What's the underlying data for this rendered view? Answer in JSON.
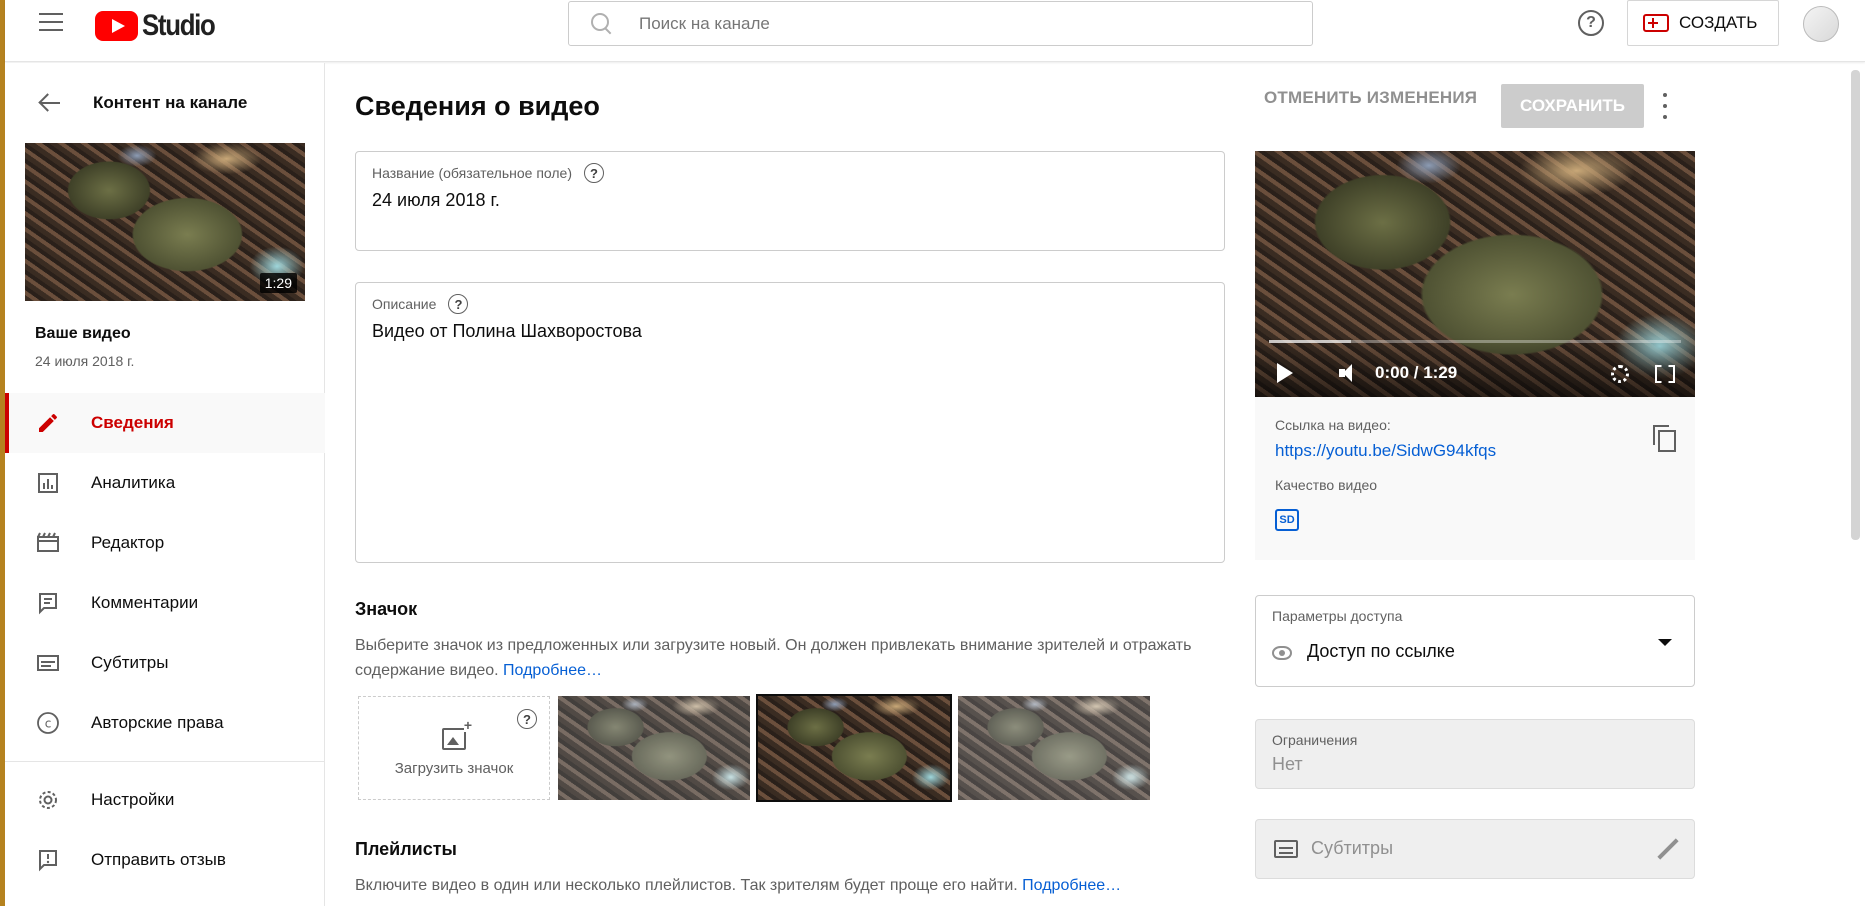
{
  "header": {
    "logo_text": "Studio",
    "search_placeholder": "Поиск на канале",
    "help_label": "?",
    "create_label": "СОЗДАТЬ"
  },
  "sidebar": {
    "back_label": "Контент на канале",
    "thumbnail_duration": "1:29",
    "your_video_label": "Ваше видео",
    "video_date": "24 июля 2018 г.",
    "items": [
      {
        "label": "Сведения",
        "icon": "pencil-icon",
        "active": true
      },
      {
        "label": "Аналитика",
        "icon": "analytics-icon",
        "active": false
      },
      {
        "label": "Редактор",
        "icon": "clapperboard-icon",
        "active": false
      },
      {
        "label": "Комментарии",
        "icon": "comment-icon",
        "active": false
      },
      {
        "label": "Субтитры",
        "icon": "subtitles-icon",
        "active": false
      },
      {
        "label": "Авторские права",
        "icon": "copyright-icon",
        "active": false
      }
    ],
    "bottom_items": [
      {
        "label": "Настройки",
        "icon": "gear-icon"
      },
      {
        "label": "Отправить отзыв",
        "icon": "feedback-icon"
      }
    ]
  },
  "main": {
    "page_title": "Сведения о видео",
    "undo_label": "ОТМЕНИТЬ ИЗМЕНЕНИЯ",
    "save_label": "СОХРАНИТЬ",
    "title_field": {
      "label": "Название (обязательное поле)",
      "value": "24 июля 2018 г."
    },
    "description_field": {
      "label": "Описание",
      "value": "Видео от Полина Шахворостова"
    },
    "thumbnail_section": {
      "title": "Значок",
      "text": "Выберите значок из предложенных или загрузите новый. Он должен привлекать внимание зрителей и отражать содержание видео.",
      "more_link": "Подробнее…",
      "upload_label": "Загрузить значок"
    },
    "playlists_section": {
      "title": "Плейлисты",
      "text": "Включите видео в один или несколько плейлистов. Так зрителям будет проще его найти.",
      "more_link": "Подробнее…"
    }
  },
  "player": {
    "time": "0:00 / 1:29"
  },
  "video_info": {
    "link_label": "Ссылка на видео:",
    "link_url": "https://youtu.be/SidwG94kfqs",
    "quality_label": "Качество видео",
    "quality_badge": "SD"
  },
  "access": {
    "label": "Параметры доступа",
    "value": "Доступ по ссылке"
  },
  "restrictions": {
    "label": "Ограничения",
    "value": "Нет"
  },
  "subtitles": {
    "label": "Субтитры"
  },
  "colors": {
    "accent_red": "#cc0000",
    "link_blue": "#065fd4",
    "save_disabled": "#cccccc"
  }
}
